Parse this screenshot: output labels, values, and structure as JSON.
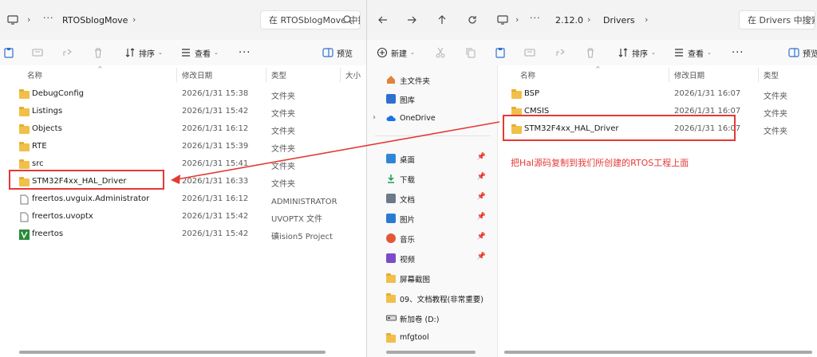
{
  "left": {
    "breadcrumbs": [
      "RTOSblogMove"
    ],
    "search_placeholder": "在 RTOSblogMove 中搜索",
    "toolbar": {
      "sort": "排序",
      "view": "查看",
      "preview": "预览"
    },
    "columns": {
      "name": "名称",
      "date": "修改日期",
      "type": "类型",
      "size": "大小"
    },
    "files": [
      {
        "name": "DebugConfig",
        "date": "2026/1/31 15:38",
        "type": "文件夹",
        "icon": "folder"
      },
      {
        "name": "Listings",
        "date": "2026/1/31 15:42",
        "type": "文件夹",
        "icon": "folder"
      },
      {
        "name": "Objects",
        "date": "2026/1/31 16:12",
        "type": "文件夹",
        "icon": "folder"
      },
      {
        "name": "RTE",
        "date": "2026/1/31 15:39",
        "type": "文件夹",
        "icon": "folder"
      },
      {
        "name": "src",
        "date": "2026/1/31 15:41",
        "type": "文件夹",
        "icon": "folder"
      },
      {
        "name": "STM32F4xx_HAL_Driver",
        "date": "2026/1/31 16:33",
        "type": "文件夹",
        "icon": "folder"
      },
      {
        "name": "freertos.uvguix.Administrator",
        "date": "2026/1/31 16:12",
        "type": "ADMINISTRATOR 文件",
        "icon": "file"
      },
      {
        "name": "freertos.uvoptx",
        "date": "2026/1/31 15:42",
        "type": "UVOPTX 文件",
        "icon": "file"
      },
      {
        "name": "freertos",
        "date": "2026/1/31 15:42",
        "type": "礦ision5 Project",
        "icon": "project"
      }
    ]
  },
  "right": {
    "breadcrumbs": [
      "2.12.0",
      "Drivers"
    ],
    "search_placeholder": "在 Drivers 中搜索",
    "toolbar": {
      "new": "新建",
      "sort": "排序",
      "view": "查看",
      "preview": "预览"
    },
    "columns": {
      "name": "名称",
      "date": "修改日期",
      "type": "类型"
    },
    "nav": [
      {
        "label": "主文件夹",
        "icon": "home",
        "color": "#e0843a"
      },
      {
        "label": "图库",
        "icon": "gallery",
        "color": "#2f6fd1"
      },
      {
        "label": "OneDrive",
        "icon": "cloud",
        "color": "#1a73e8",
        "expand": true
      },
      {
        "label": "桌面",
        "icon": "desktop",
        "color": "#2f86d6",
        "pinned": true
      },
      {
        "label": "下载",
        "icon": "download",
        "color": "#1e9a5b",
        "pinned": true
      },
      {
        "label": "文档",
        "icon": "docs",
        "color": "#6c7a89",
        "pinned": true
      },
      {
        "label": "图片",
        "icon": "pictures",
        "color": "#2b7bd3",
        "pinned": true
      },
      {
        "label": "音乐",
        "icon": "music",
        "color": "#e2573a",
        "pinned": true
      },
      {
        "label": "视频",
        "icon": "video",
        "color": "#7a4cc9",
        "pinned": true
      },
      {
        "label": "屏幕截图",
        "icon": "folder",
        "color": "#f0c04a"
      },
      {
        "label": "09、文档教程(非常重要)",
        "icon": "folder",
        "color": "#f0c04a"
      },
      {
        "label": "新加卷 (D:)",
        "icon": "drive",
        "color": "#555555"
      },
      {
        "label": "mfgtool",
        "icon": "folder",
        "color": "#f0c04a"
      }
    ],
    "files": [
      {
        "name": "BSP",
        "date": "2026/1/31 16:07",
        "type": "文件夹"
      },
      {
        "name": "CMSIS",
        "date": "2026/1/31 16:07",
        "type": "文件夹"
      },
      {
        "name": "STM32F4xx_HAL_Driver",
        "date": "2026/1/31 16:07",
        "type": "文件夹"
      }
    ]
  },
  "annotation": {
    "text": "把Hal源码复制到我们所创建的RTOS工程上面",
    "color": "#e53935"
  },
  "sort_caret": "^"
}
